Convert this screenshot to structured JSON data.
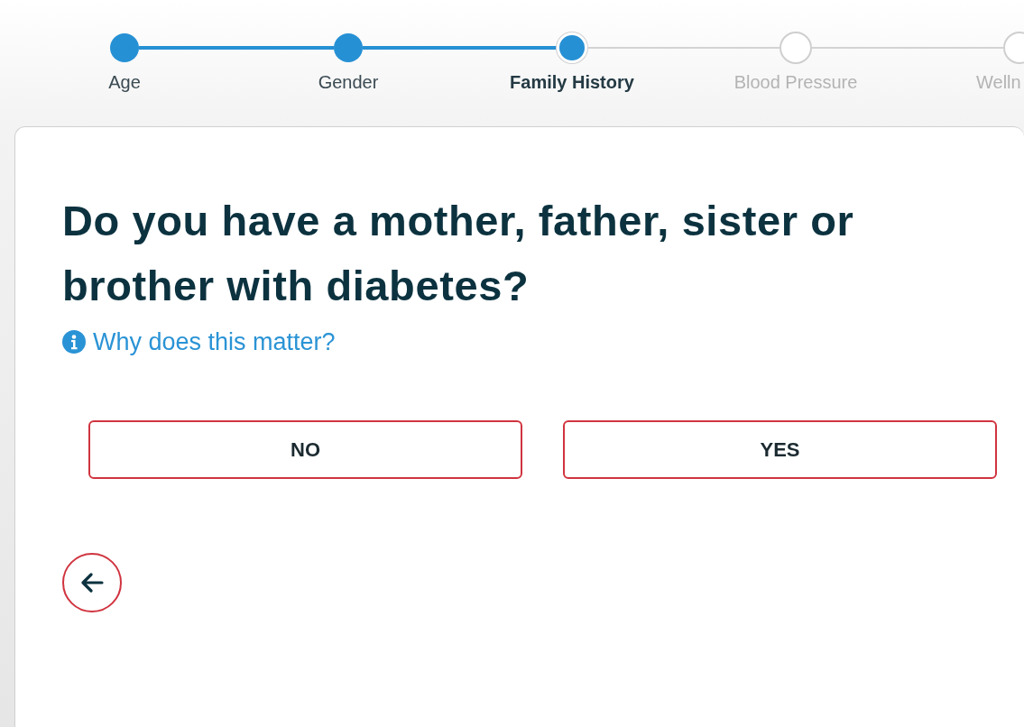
{
  "steps": [
    {
      "label": "Age",
      "completed": true,
      "selected": false
    },
    {
      "label": "Gender",
      "completed": true,
      "selected": false
    },
    {
      "label": "Family History",
      "completed": false,
      "selected": true
    },
    {
      "label": "Blood Pressure",
      "completed": false,
      "selected": false
    },
    {
      "label": "Welln",
      "completed": false,
      "selected": false
    }
  ],
  "question": {
    "title": "Do you have a mother, father, sister or brother with diabetes?",
    "help_link": "Why does this matter?",
    "answers": [
      {
        "label": "NO"
      },
      {
        "label": "YES"
      }
    ]
  }
}
